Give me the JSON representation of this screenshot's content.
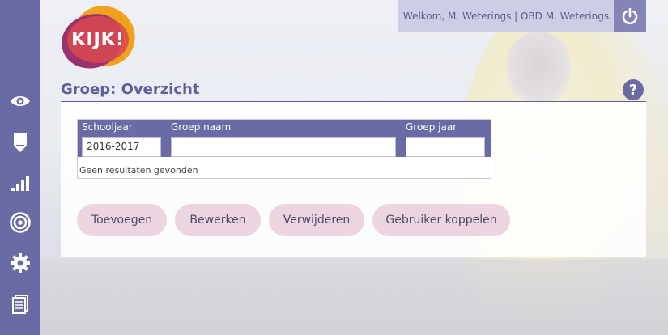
{
  "header": {
    "logo_text": "KIJK!",
    "welcome_text": "Welkom, M. Weterings | OBD M. Weterings",
    "power_icon": "power-icon"
  },
  "sidebar": {
    "items": [
      {
        "icon": "eye-icon"
      },
      {
        "icon": "marker-icon"
      },
      {
        "icon": "bar-chart-icon"
      },
      {
        "icon": "target-icon"
      },
      {
        "icon": "gear-icon"
      },
      {
        "icon": "document-icon"
      }
    ]
  },
  "page": {
    "title": "Groep: Overzicht",
    "help_label": "?"
  },
  "table": {
    "columns": [
      "Schooljaar",
      "Groep naam",
      "Groep jaar"
    ],
    "filters": [
      "2016-2017",
      "",
      ""
    ],
    "empty_message": "Geen resultaten gevonden"
  },
  "actions": {
    "add": "Toevoegen",
    "edit": "Bewerken",
    "delete": "Verwijderen",
    "link_user": "Gebruiker koppelen"
  },
  "colors": {
    "sidebar": "#6a6aa5",
    "accent": "#5d5f98",
    "button": "#edd4e1"
  }
}
